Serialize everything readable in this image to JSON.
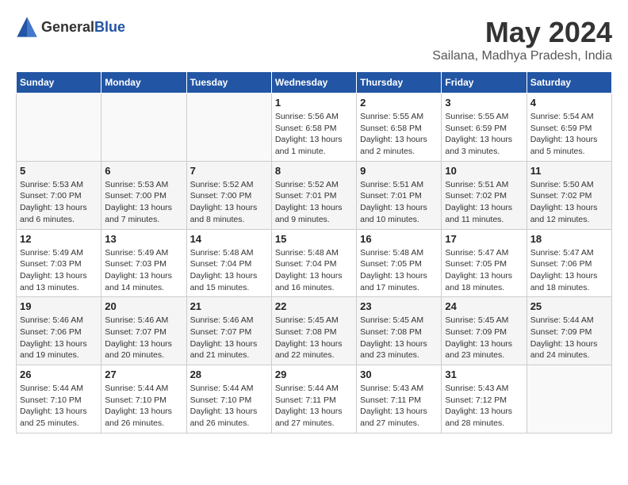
{
  "header": {
    "logo_general": "General",
    "logo_blue": "Blue",
    "month": "May 2024",
    "location": "Sailana, Madhya Pradesh, India"
  },
  "weekdays": [
    "Sunday",
    "Monday",
    "Tuesday",
    "Wednesday",
    "Thursday",
    "Friday",
    "Saturday"
  ],
  "weeks": [
    [
      {
        "day": "",
        "sunrise": "",
        "sunset": "",
        "daylight": ""
      },
      {
        "day": "",
        "sunrise": "",
        "sunset": "",
        "daylight": ""
      },
      {
        "day": "",
        "sunrise": "",
        "sunset": "",
        "daylight": ""
      },
      {
        "day": "1",
        "sunrise": "Sunrise: 5:56 AM",
        "sunset": "Sunset: 6:58 PM",
        "daylight": "Daylight: 13 hours and 1 minute."
      },
      {
        "day": "2",
        "sunrise": "Sunrise: 5:55 AM",
        "sunset": "Sunset: 6:58 PM",
        "daylight": "Daylight: 13 hours and 2 minutes."
      },
      {
        "day": "3",
        "sunrise": "Sunrise: 5:55 AM",
        "sunset": "Sunset: 6:59 PM",
        "daylight": "Daylight: 13 hours and 3 minutes."
      },
      {
        "day": "4",
        "sunrise": "Sunrise: 5:54 AM",
        "sunset": "Sunset: 6:59 PM",
        "daylight": "Daylight: 13 hours and 5 minutes."
      }
    ],
    [
      {
        "day": "5",
        "sunrise": "Sunrise: 5:53 AM",
        "sunset": "Sunset: 7:00 PM",
        "daylight": "Daylight: 13 hours and 6 minutes."
      },
      {
        "day": "6",
        "sunrise": "Sunrise: 5:53 AM",
        "sunset": "Sunset: 7:00 PM",
        "daylight": "Daylight: 13 hours and 7 minutes."
      },
      {
        "day": "7",
        "sunrise": "Sunrise: 5:52 AM",
        "sunset": "Sunset: 7:00 PM",
        "daylight": "Daylight: 13 hours and 8 minutes."
      },
      {
        "day": "8",
        "sunrise": "Sunrise: 5:52 AM",
        "sunset": "Sunset: 7:01 PM",
        "daylight": "Daylight: 13 hours and 9 minutes."
      },
      {
        "day": "9",
        "sunrise": "Sunrise: 5:51 AM",
        "sunset": "Sunset: 7:01 PM",
        "daylight": "Daylight: 13 hours and 10 minutes."
      },
      {
        "day": "10",
        "sunrise": "Sunrise: 5:51 AM",
        "sunset": "Sunset: 7:02 PM",
        "daylight": "Daylight: 13 hours and 11 minutes."
      },
      {
        "day": "11",
        "sunrise": "Sunrise: 5:50 AM",
        "sunset": "Sunset: 7:02 PM",
        "daylight": "Daylight: 13 hours and 12 minutes."
      }
    ],
    [
      {
        "day": "12",
        "sunrise": "Sunrise: 5:49 AM",
        "sunset": "Sunset: 7:03 PM",
        "daylight": "Daylight: 13 hours and 13 minutes."
      },
      {
        "day": "13",
        "sunrise": "Sunrise: 5:49 AM",
        "sunset": "Sunset: 7:03 PM",
        "daylight": "Daylight: 13 hours and 14 minutes."
      },
      {
        "day": "14",
        "sunrise": "Sunrise: 5:48 AM",
        "sunset": "Sunset: 7:04 PM",
        "daylight": "Daylight: 13 hours and 15 minutes."
      },
      {
        "day": "15",
        "sunrise": "Sunrise: 5:48 AM",
        "sunset": "Sunset: 7:04 PM",
        "daylight": "Daylight: 13 hours and 16 minutes."
      },
      {
        "day": "16",
        "sunrise": "Sunrise: 5:48 AM",
        "sunset": "Sunset: 7:05 PM",
        "daylight": "Daylight: 13 hours and 17 minutes."
      },
      {
        "day": "17",
        "sunrise": "Sunrise: 5:47 AM",
        "sunset": "Sunset: 7:05 PM",
        "daylight": "Daylight: 13 hours and 18 minutes."
      },
      {
        "day": "18",
        "sunrise": "Sunrise: 5:47 AM",
        "sunset": "Sunset: 7:06 PM",
        "daylight": "Daylight: 13 hours and 18 minutes."
      }
    ],
    [
      {
        "day": "19",
        "sunrise": "Sunrise: 5:46 AM",
        "sunset": "Sunset: 7:06 PM",
        "daylight": "Daylight: 13 hours and 19 minutes."
      },
      {
        "day": "20",
        "sunrise": "Sunrise: 5:46 AM",
        "sunset": "Sunset: 7:07 PM",
        "daylight": "Daylight: 13 hours and 20 minutes."
      },
      {
        "day": "21",
        "sunrise": "Sunrise: 5:46 AM",
        "sunset": "Sunset: 7:07 PM",
        "daylight": "Daylight: 13 hours and 21 minutes."
      },
      {
        "day": "22",
        "sunrise": "Sunrise: 5:45 AM",
        "sunset": "Sunset: 7:08 PM",
        "daylight": "Daylight: 13 hours and 22 minutes."
      },
      {
        "day": "23",
        "sunrise": "Sunrise: 5:45 AM",
        "sunset": "Sunset: 7:08 PM",
        "daylight": "Daylight: 13 hours and 23 minutes."
      },
      {
        "day": "24",
        "sunrise": "Sunrise: 5:45 AM",
        "sunset": "Sunset: 7:09 PM",
        "daylight": "Daylight: 13 hours and 23 minutes."
      },
      {
        "day": "25",
        "sunrise": "Sunrise: 5:44 AM",
        "sunset": "Sunset: 7:09 PM",
        "daylight": "Daylight: 13 hours and 24 minutes."
      }
    ],
    [
      {
        "day": "26",
        "sunrise": "Sunrise: 5:44 AM",
        "sunset": "Sunset: 7:10 PM",
        "daylight": "Daylight: 13 hours and 25 minutes."
      },
      {
        "day": "27",
        "sunrise": "Sunrise: 5:44 AM",
        "sunset": "Sunset: 7:10 PM",
        "daylight": "Daylight: 13 hours and 26 minutes."
      },
      {
        "day": "28",
        "sunrise": "Sunrise: 5:44 AM",
        "sunset": "Sunset: 7:10 PM",
        "daylight": "Daylight: 13 hours and 26 minutes."
      },
      {
        "day": "29",
        "sunrise": "Sunrise: 5:44 AM",
        "sunset": "Sunset: 7:11 PM",
        "daylight": "Daylight: 13 hours and 27 minutes."
      },
      {
        "day": "30",
        "sunrise": "Sunrise: 5:43 AM",
        "sunset": "Sunset: 7:11 PM",
        "daylight": "Daylight: 13 hours and 27 minutes."
      },
      {
        "day": "31",
        "sunrise": "Sunrise: 5:43 AM",
        "sunset": "Sunset: 7:12 PM",
        "daylight": "Daylight: 13 hours and 28 minutes."
      },
      {
        "day": "",
        "sunrise": "",
        "sunset": "",
        "daylight": ""
      }
    ]
  ]
}
